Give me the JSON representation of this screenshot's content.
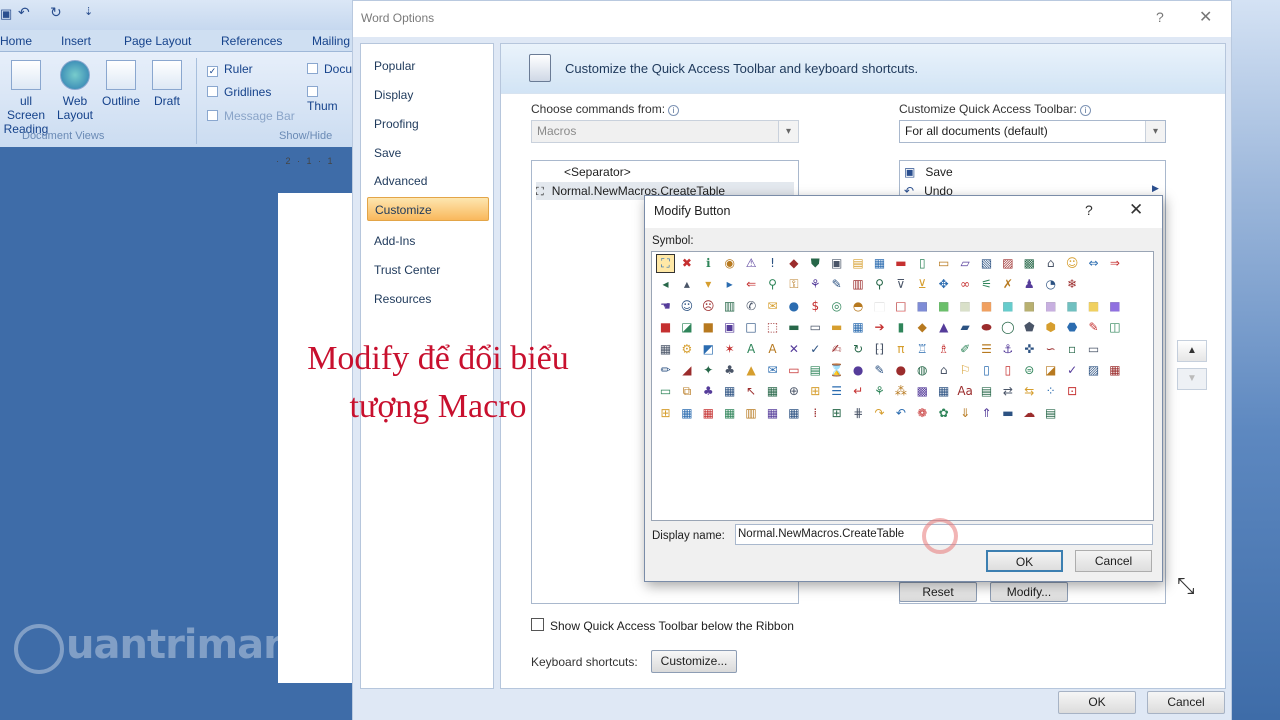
{
  "word": {
    "ribbon_tabs": [
      "Home",
      "Insert",
      "Page Layout",
      "References",
      "Mailing"
    ],
    "views": {
      "buttons": [
        {
          "line1": "ull Screen",
          "line2": "Reading"
        },
        {
          "line1": "Web",
          "line2": "Layout"
        },
        {
          "line1": "Outline",
          "line2": ""
        },
        {
          "line1": "Draft",
          "line2": ""
        }
      ],
      "group_label": "Document Views"
    },
    "show_hide": {
      "ruler": "Ruler",
      "gridlines": "Gridlines",
      "message_bar": "Message Bar",
      "docu": "Docu",
      "thum": "Thum",
      "group_label": "Show/Hide"
    },
    "ruler_text": "· 2 · 1 · 1",
    "watermark": "uantrimang"
  },
  "word_options": {
    "title": "Word Options",
    "help_glyph": "?",
    "close_glyph": "✕",
    "nav_items": [
      "Popular",
      "Display",
      "Proofing",
      "Save",
      "Advanced",
      "Customize",
      "Add-Ins",
      "Trust Center",
      "Resources"
    ],
    "selected_nav": "Customize",
    "header": "Customize the Quick Access Toolbar and keyboard shortcuts.",
    "choose_label": "Choose commands from:",
    "choose_value": "Macros",
    "customize_label": "Customize Quick Access Toolbar:",
    "customize_value": "For all documents (default)",
    "left_list": [
      "<Separator>",
      "Normal.NewMacros.CreateTable"
    ],
    "right_list": [
      "Save",
      "Undo"
    ],
    "reset_label": "Reset",
    "modify_label": "Modify...",
    "show_below_label": "Show Quick Access Toolbar below the Ribbon",
    "keyboard_label": "Keyboard shortcuts:",
    "customize_btn": "Customize...",
    "ok": "OK",
    "cancel": "Cancel"
  },
  "modify_button": {
    "title": "Modify Button",
    "help_glyph": "?",
    "close_glyph": "✕",
    "symbol_label": "Symbol:",
    "display_name_label": "Display name:",
    "display_name_value": "Normal.NewMacros.CreateTable",
    "ok": "OK",
    "cancel": "Cancel",
    "symbols": [
      [
        "⛶",
        "✖",
        "ℹ",
        "◉",
        "⚠",
        "!",
        "◆",
        "⛊",
        "▣",
        "▤",
        "▦",
        "▬",
        "▯",
        "▭",
        "▱",
        "▧",
        "▨",
        "▩",
        "⌂",
        "☺",
        "⇔",
        "⇒"
      ],
      [
        "◂",
        "▴",
        "▾",
        "▸",
        "⇐",
        "⚲",
        "⚿",
        "⚘",
        "✎",
        "▥",
        "⚲",
        "⊽",
        "⊻",
        "✥",
        "∞",
        "⚟",
        "✗",
        "♟",
        "◔",
        "❄",
        "",
        ""
      ],
      [
        "☚",
        "☺",
        "☹",
        "▥",
        "✆",
        "✉",
        "●",
        "$",
        "◎",
        "◓",
        "■",
        "□",
        "■",
        "■",
        "■",
        "■",
        "■",
        "■",
        "■",
        "■",
        "■",
        "■"
      ],
      [
        "■",
        "◪",
        "■",
        "▣",
        "□",
        "⬚",
        "▬",
        "▭",
        "▬",
        "▦",
        "➔",
        "▮",
        "◆",
        "▲",
        "▰",
        "⬬",
        "◯",
        "⬟",
        "⬢",
        "⬣",
        "✎",
        "◫"
      ],
      [
        "▦",
        "⚙",
        "◩",
        "✶",
        "A",
        "A",
        "✕",
        "✓",
        "✍",
        "↻",
        "⁅⁆",
        "π",
        "♖",
        "♗",
        "✐",
        "☰",
        "⚓",
        "✜",
        "∽",
        "▫",
        "▭",
        ""
      ],
      [
        "✏",
        "◢",
        "✦",
        "♣",
        "▲",
        "✉",
        "▭",
        "▤",
        "⌛",
        "●",
        "✎",
        "●",
        "◍",
        "⌂",
        "⚐",
        "▯",
        "▯",
        "⊜",
        "◪",
        "✓",
        "▨",
        "▦"
      ],
      [
        "▭",
        "⧉",
        "♣",
        "▦",
        "↖",
        "▦",
        "⊕",
        "⊞",
        "☰",
        "↵",
        "⚘",
        "⁂",
        "▩",
        "▦",
        "Aa",
        "▤",
        "⇄",
        "⇆",
        "⁘",
        "⊡",
        "",
        ""
      ],
      [
        "⊞",
        "▦",
        "▦",
        "▦",
        "▥",
        "▦",
        "▦",
        "⁞",
        "⊞",
        "⋕",
        "↷",
        "↶",
        "❁",
        "✿",
        "⇓",
        "⇑",
        "▬",
        "☁",
        "▤",
        "",
        "",
        ""
      ]
    ]
  },
  "annotation": {
    "line1": "Modify để đổi biểu",
    "line2": "tượng Macro"
  }
}
